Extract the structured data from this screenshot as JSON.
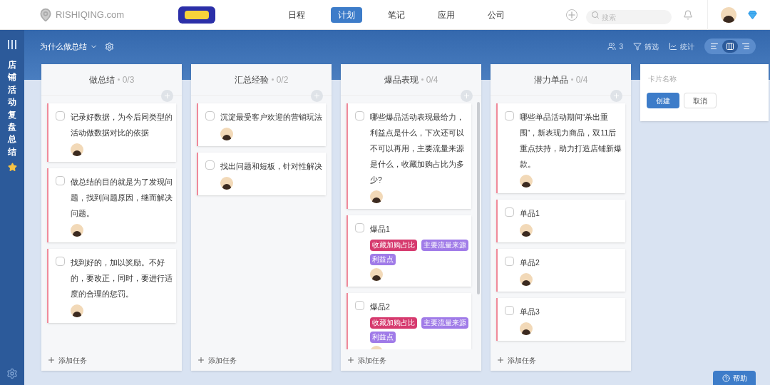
{
  "brand": {
    "name": "RISHIQING.com"
  },
  "nav": [
    {
      "label": "日程",
      "selected": false
    },
    {
      "label": "计划",
      "selected": true
    },
    {
      "label": "笔记",
      "selected": false
    },
    {
      "label": "应用",
      "selected": false
    },
    {
      "label": "公司",
      "selected": false
    }
  ],
  "search": {
    "placeholder": "搜索"
  },
  "sidebar": {
    "title": "店铺活动复盘总结"
  },
  "toolbar": {
    "project": "为什么做总结",
    "members": "3",
    "filter": "筛选",
    "stats": "统计",
    "views": [
      {
        "kind": "list",
        "selected": false
      },
      {
        "kind": "board",
        "selected": true
      },
      {
        "kind": "timeline",
        "selected": false
      }
    ]
  },
  "columns": [
    {
      "title": "做总结",
      "count": "0/3",
      "add_task": "添加任务",
      "cards": [
        {
          "text": "记录好数据，为今后同类型的活动做数据对比的依据",
          "checked": false
        },
        {
          "text": "做总结的目的就是为了发现问题，找到问题原因，继而解决问题。",
          "checked": false
        },
        {
          "text": "找到好的，加以奖励。不好的，要改正，同时，要进行适度的合理的惩罚。",
          "checked": false
        }
      ]
    },
    {
      "title": "汇总经验",
      "count": "0/2",
      "add_task": "添加任务",
      "cards": [
        {
          "text": "沉淀最受客户欢迎的营销玩法",
          "checked": false
        },
        {
          "text": "找出问题和短板，针对性解决",
          "checked": false
        }
      ]
    },
    {
      "title": "爆品表现",
      "count": "0/4",
      "add_task": "添加任务",
      "cards": [
        {
          "text": "哪些爆品活动表现最给力，利益点是什么，下次还可以不可以再用，主要流量来源是什么，收藏加购占比为多少?",
          "checked": false
        },
        {
          "text": "爆品1",
          "checked": false,
          "tags": [
            {
              "label": "收藏加购占比",
              "color": "#d63a6e"
            },
            {
              "label": "主要流量来源",
              "color": "#a07be8"
            },
            {
              "label": "利益点",
              "color": "#a07be8"
            }
          ]
        },
        {
          "text": "爆品2",
          "checked": false,
          "tags": [
            {
              "label": "收藏加购占比",
              "color": "#d63a6e"
            },
            {
              "label": "主要流量来源",
              "color": "#a07be8"
            },
            {
              "label": "利益点",
              "color": "#a07be8"
            }
          ]
        }
      ]
    },
    {
      "title": "潜力单品",
      "count": "0/4",
      "add_task": "添加任务",
      "cards": [
        {
          "text": "哪些单品活动期间“杀出重围”，新表现力商品，双11后重点扶持，助力打造店铺新爆款。",
          "checked": false
        },
        {
          "text": "单品1",
          "checked": false
        },
        {
          "text": "单品2",
          "checked": false
        },
        {
          "text": "单品3",
          "checked": false
        }
      ]
    }
  ],
  "new_list": {
    "placeholder": "卡片名称",
    "create": "创建",
    "cancel": "取消"
  },
  "help": "帮助"
}
